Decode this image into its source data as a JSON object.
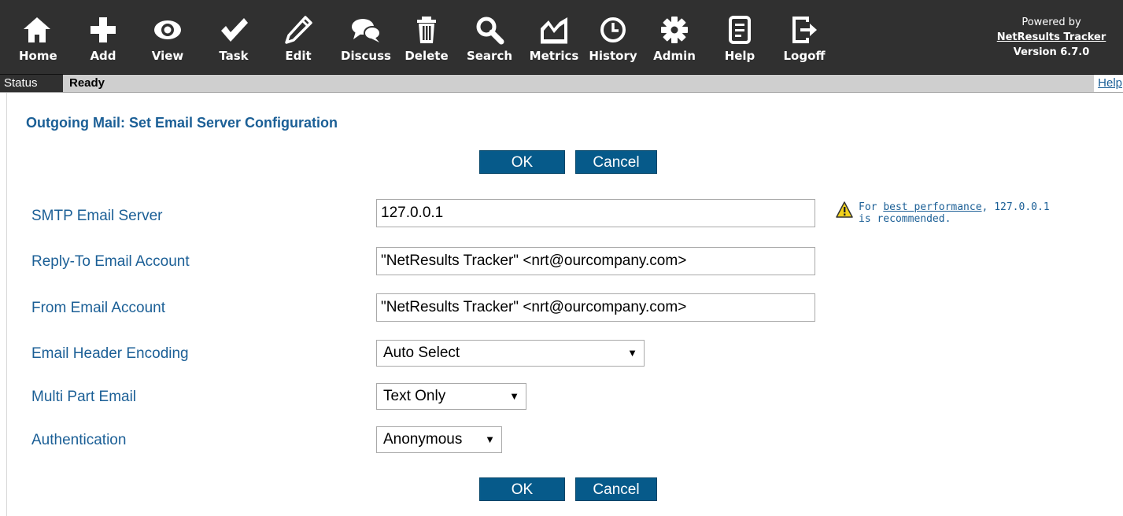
{
  "toolbar": {
    "items": [
      {
        "label": "Home",
        "icon": "home-icon"
      },
      {
        "label": "Add",
        "icon": "plus-icon"
      },
      {
        "label": "View",
        "icon": "eye-icon"
      },
      {
        "label": "Task",
        "icon": "checkmark-icon"
      },
      {
        "label": "Edit",
        "icon": "pencil-icon"
      },
      {
        "label": "Discuss",
        "icon": "chat-bubbles-icon"
      },
      {
        "label": "Delete",
        "icon": "trash-icon"
      },
      {
        "label": "Search",
        "icon": "magnifier-icon"
      },
      {
        "label": "Metrics",
        "icon": "chart-icon"
      },
      {
        "label": "History",
        "icon": "clock-icon"
      },
      {
        "label": "Admin",
        "icon": "gear-icon"
      },
      {
        "label": "Help",
        "icon": "document-icon"
      },
      {
        "label": "Logoff",
        "icon": "logoff-icon"
      }
    ],
    "powered_by": "Powered by",
    "product_link": "NetResults Tracker",
    "version": "Version 6.7.0"
  },
  "status": {
    "label": "Status",
    "value": "Ready",
    "help": "Help"
  },
  "main": {
    "title": "Outgoing Mail: Set Email Server Configuration",
    "ok_label": "OK",
    "cancel_label": "Cancel",
    "fields": {
      "smtp": {
        "label": "SMTP Email Server",
        "value": "127.0.0.1"
      },
      "reply_to": {
        "label": "Reply-To Email Account",
        "value": "\"NetResults Tracker\" <nrt@ourcompany.com>"
      },
      "from": {
        "label": "From Email Account",
        "value": "\"NetResults Tracker\" <nrt@ourcompany.com>"
      },
      "header_encoding": {
        "label": "Email Header Encoding",
        "value": "Auto Select"
      },
      "multipart": {
        "label": "Multi Part Email",
        "value": "Text Only"
      },
      "authentication": {
        "label": "Authentication",
        "value": "Anonymous"
      }
    },
    "hint": {
      "prefix": "For ",
      "link": "best performance",
      "suffix": ", 127.0.0.1",
      "line2": "is recommended.",
      "icon": "warning-icon"
    },
    "select_arrow": "▼"
  },
  "colors": {
    "toolbar_bg": "#303030",
    "accent": "#1b5f96",
    "button_bg": "#065a8a",
    "warning": "#f2d21b"
  }
}
